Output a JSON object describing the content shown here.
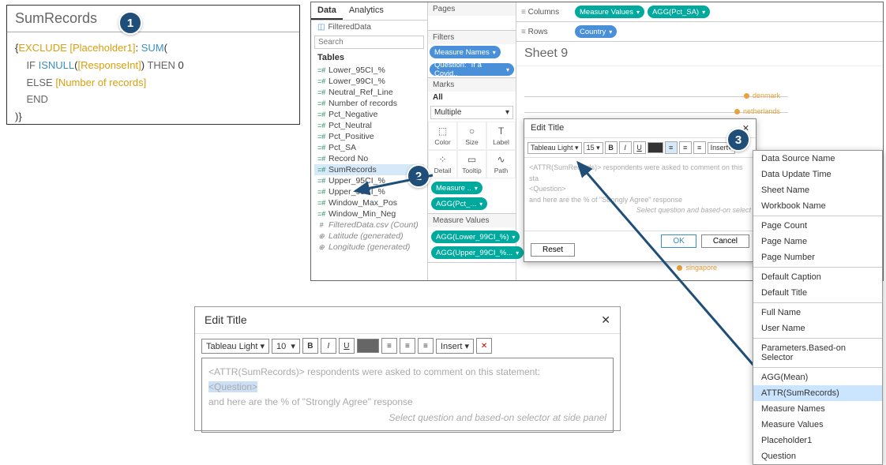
{
  "badges": {
    "b1": "1",
    "b2": "2",
    "b3": "3"
  },
  "formula": {
    "name": "SumRecords",
    "line1a": "{",
    "line1b": "EXCLUDE",
    "line1c": " [Placeholder1]",
    "line1d": ": ",
    "line1e": "SUM",
    "line1f": "(",
    "line2a": "    IF ",
    "line2b": "ISNULL",
    "line2c": "(",
    "line2d": "[ResponseInt]",
    "line2e": ")",
    "line2f": " THEN ",
    "line2g": "0",
    "line3a": "    ELSE ",
    "line3b": "[Number of records]",
    "line4": "    END",
    "line5": ")}"
  },
  "tableau": {
    "tabs": {
      "data": "Data",
      "analytics": "Analytics"
    },
    "filteredData": "FilteredData",
    "searchPlaceholder": "Search",
    "tablesHdr": "Tables",
    "fields": [
      "Lower_95CI_%",
      "Lower_99CI_%",
      "Neutral_Ref_Line",
      "Number of records",
      "Pct_Negative",
      "Pct_Neutral",
      "Pct_Positive",
      "Pct_SA",
      "Record No",
      "SumRecords",
      "Upper_95CI_%",
      "Upper_99CI_%",
      "Window_Max_Pos",
      "Window_Min_Neg"
    ],
    "fieldsItalic": [
      "FilteredData.csv (Count)",
      "Latitude (generated)",
      "Longitude (generated)"
    ],
    "pages": "Pages",
    "filters": "Filters",
    "filterPills": [
      "Measure Names",
      "Question: \"If a Covid.."
    ],
    "marks": "Marks",
    "marksAll": "All",
    "marksType": "Multiple",
    "marksCells": {
      "color": "Color",
      "size": "Size",
      "label": "Label",
      "detail": "Detail",
      "tooltip": "Tooltip",
      "path": "Path"
    },
    "marksPills": [
      "Measure ..",
      "AGG(Pct_..."
    ],
    "measureValuesHdr": "Measure Values",
    "measurePills": [
      "AGG(Lower_99CI_%)",
      "AGG(Upper_99CI_%..."
    ],
    "columns": "Columns",
    "rows": "Rows",
    "colPills": [
      "Measure Values",
      "AGG(Pct_SA)"
    ],
    "rowPills": [
      "Country"
    ],
    "sheetTitle": "Sheet 9",
    "vizLabels": [
      "denmark",
      "netherlands",
      "singapore"
    ]
  },
  "editSmall": {
    "title": "Edit Title",
    "font": "Tableau Light",
    "size": "15",
    "insert": "Insert",
    "line1": "<ATTR(SumRecords)> respondents were asked to comment on this sta",
    "line2": "<Question>",
    "line3": "and here are the % of \"Strongly Agree\" response",
    "line4": "Select question and based-on select",
    "reset": "Reset",
    "ok": "OK",
    "cancel": "Cancel"
  },
  "insertMenu": {
    "g1": [
      "Data Source Name",
      "Data Update Time",
      "Sheet Name",
      "Workbook Name"
    ],
    "g2": [
      "Page Count",
      "Page Name",
      "Page Number"
    ],
    "g3": [
      "Default Caption",
      "Default Title"
    ],
    "g4": [
      "Full Name",
      "User Name"
    ],
    "g5": [
      "Parameters.Based-on Selector"
    ],
    "g6": [
      "AGG(Mean)",
      "ATTR(SumRecords)",
      "Measure Names",
      "Measure Values",
      "Placeholder1",
      "Question"
    ],
    "highlight": "ATTR(SumRecords)"
  },
  "editLarge": {
    "title": "Edit Title",
    "font": "Tableau Light",
    "size": "10",
    "insert": "Insert",
    "line1a": "<ATTR(SumRecords)>",
    "line1b": " respondents were asked to comment on this statement:",
    "line2": "<Question>",
    "line3": "and here are the % of \"Strongly Agree\" response",
    "line4": "Select question and based-on selector at side panel"
  }
}
